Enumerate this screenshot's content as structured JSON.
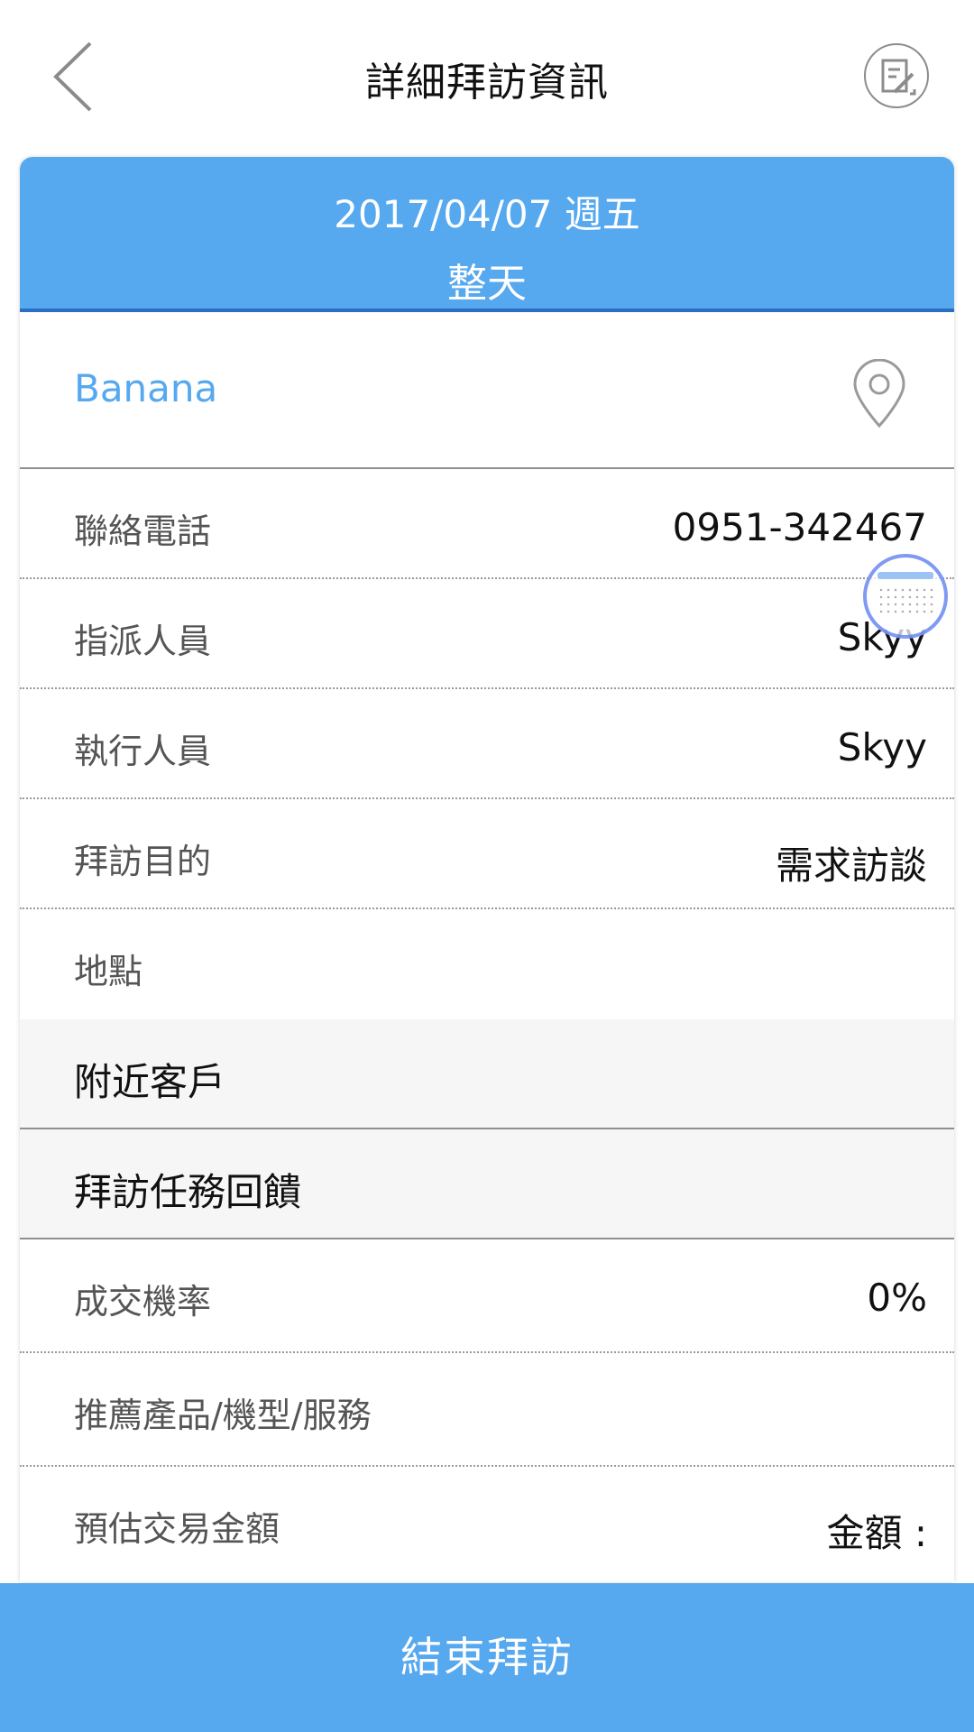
{
  "header": {
    "title": "詳細拜訪資訊",
    "back_icon": "chevron-left-icon",
    "edit_icon": "edit-note-icon"
  },
  "visit": {
    "date": "2017/04/07 週五",
    "time": "整天",
    "customer_name": "Banana",
    "location_icon": "map-pin-icon"
  },
  "details": [
    {
      "label": "聯絡電話",
      "value": "0951-342467"
    },
    {
      "label": "指派人員",
      "value": "Skyy"
    },
    {
      "label": "執行人員",
      "value": "Skyy"
    },
    {
      "label": "拜訪目的",
      "value": "需求訪談"
    },
    {
      "label": "地點",
      "value": ""
    }
  ],
  "sections": {
    "nearby_customers": "附近客戶",
    "visit_feedback": "拜訪任務回饋"
  },
  "feedback": [
    {
      "label": "成交機率",
      "value": "0%"
    },
    {
      "label": "推薦產品/機型/服務",
      "value": ""
    },
    {
      "label": "預估交易金額",
      "value": "金額 :"
    }
  ],
  "footer": {
    "end_visit_label": "結束拜訪"
  },
  "colors": {
    "accent": "#56a8ef",
    "accent_dark": "#2a6fc4",
    "section_bg": "#f6f6f6"
  }
}
